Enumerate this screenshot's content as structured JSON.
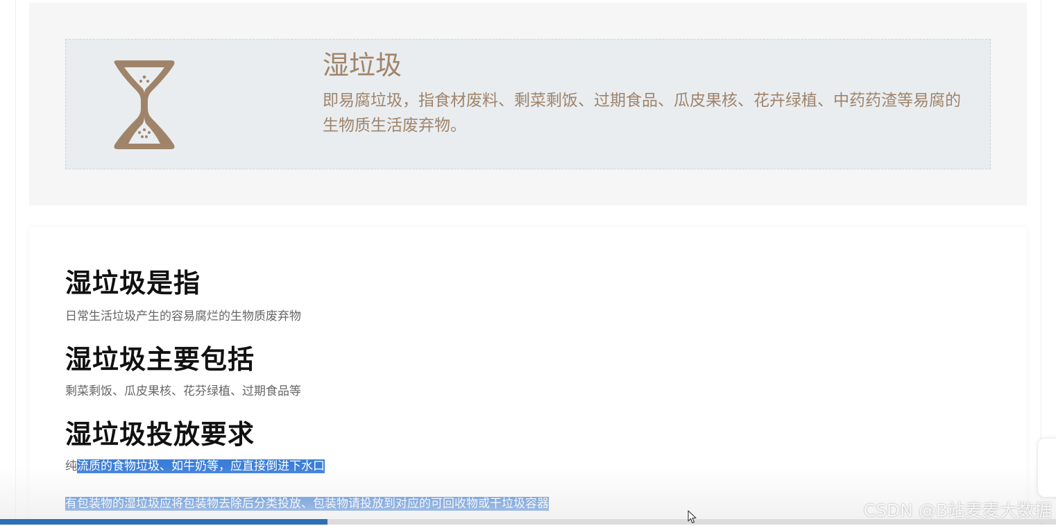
{
  "feature": {
    "icon": "hourglass-icon",
    "title": "湿垃圾",
    "description": "即易腐垃圾，指食材废料、剩菜剩饭、过期食品、瓜皮果核、花卉绿植、中药药渣等易腐的生物质生活废弃物。"
  },
  "sections": [
    {
      "heading": "湿垃圾是指",
      "text": "日常生活垃圾产生的容易腐烂的生物质废弃物"
    },
    {
      "heading": "湿垃圾主要包括",
      "text": "剩菜剩饭、瓜皮果核、花芬绿植、过期食品等"
    },
    {
      "heading": "湿垃圾投放要求",
      "text_prefix": "纯",
      "text_highlighted": "流质的食物垃圾、如牛奶等，应直接倒进下水口",
      "text2_highlighted": "有包装物的湿垃圾应将包装物去除后分类投放、包装物请投放到对应的可回收物或干垃圾容器"
    }
  ],
  "video": {
    "progress": 0.31
  },
  "watermark": "CSDN @B站麦麦大数据",
  "colors": {
    "accent_brown": "#a0846a",
    "selection_blue": "#3b7ed8",
    "progress_blue": "#2f6fb8"
  }
}
